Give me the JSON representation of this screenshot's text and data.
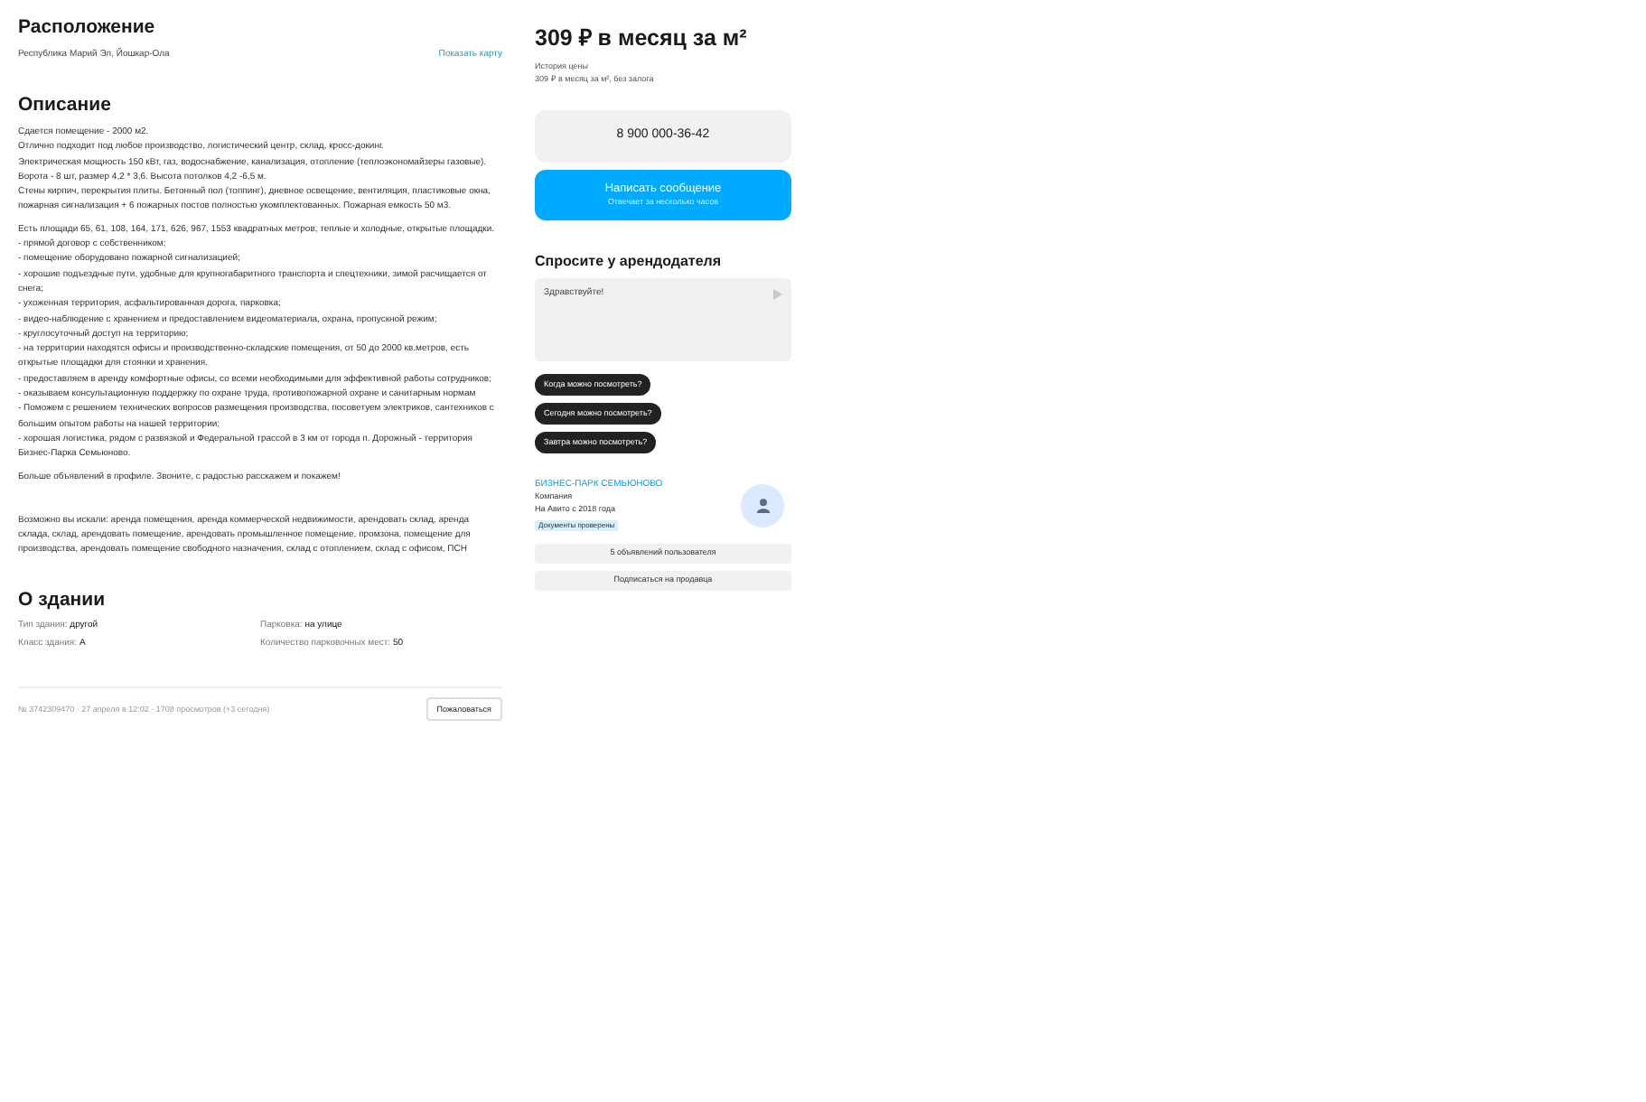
{
  "location": {
    "title": "Расположение",
    "address": "Республика Марий Эл, Йошкар-Ола",
    "map_link": "Показать карту"
  },
  "description": {
    "title": "Описание",
    "blocks": [
      [
        "Сдается помещение - 2000 м2.",
        "Отлично подходит под любое производство, логистический центр, склад, кросс-докинг.",
        "Электрическая мощность 150 кВт, газ, водоснабжение, канализация, отопление (теплоэкономайзеры газовые).",
        "Ворота - 8 шт, размер 4,2 * 3,6. Высота потолков 4,2 -6,5 м.",
        "Стены кирпич, перекрытия плиты. Бетонный пол (топпинг), дневное освещение, вентиляция, пластиковые окна, пожарная сигнализация + 6 пожарных постов полностью укомплектованных. Пожарная емкость 50 м3."
      ],
      [
        "Есть площади 65, 61, 108, 164, 171, 626, 967, 1553 квадратных метров, теплые и холодные, открытые площадки.",
        "- прямой договор с собственником;",
        "- помещение оборудовано пожарной сигнализацией;",
        "- хорошие подъездные пути, удобные для крупногабаритного транспорта и спецтехники, зимой расчищается от снега;",
        "- ухоженная территория, асфальтированная дорога, парковка;",
        "- видео-наблюдение с хранением и предоставлением видеоматериала, охрана, пропускной режим;",
        "- круглосуточный доступ на территорию;",
        "- на территории находятся офисы и производственно-складские помещения, от 50 до 2000 кв.метров, есть открытые площадки для стоянки и хранения.",
        "- предоставляем в аренду комфортные офисы, со всеми необходимыми для эффективной работы сотрудников;",
        "- оказываем консультационную поддержку по охране труда, противопожарной охране и санитарным нормам",
        "- Поможем с решением технических вопросов размещения производства, посоветуем электриков, сантехников с большим опытом работы на нашей территории;",
        "- хорошая логистика, рядом с развязкой и Федеральной трассой в 3 км от города п. Дорожный - территория Бизнес-Парка Семьюново."
      ],
      [
        "Больше объявлений в профиле. Звоните, с радостью расскажем и покажем!"
      ]
    ],
    "keywords": "Возможно вы искали: аренда помещения, аренда коммерческой недвижимости, арендовать склад, аренда склада, склад, арендовать помещение, арендовать промышленное помещение, промзона, помещение для производства, арендовать помещение свободного назначения, склад с отоплением, склад с офисом, ПСН"
  },
  "building": {
    "title": "О здании",
    "params": [
      {
        "label": "Тип здания:",
        "value": "другой"
      },
      {
        "label": "Парковка:",
        "value": "на улице"
      },
      {
        "label": "Класс здания:",
        "value": "А"
      },
      {
        "label": "Количество парковочных мест:",
        "value": "50"
      }
    ]
  },
  "footer": {
    "info": "№ 3742309470 · 27 апреля в 12:02 · 1708 просмотров (+3 сегодня)",
    "report_button": "Пожаловаться"
  },
  "price": {
    "title": "309 ₽ в месяц за м²",
    "history_link": "История цены",
    "note": "309 ₽ в месяц за м², без залога"
  },
  "phone_button": "8 900 000-36-42",
  "message_button": {
    "label": "Написать сообщение",
    "sublabel": "Отвечает за несколько часов"
  },
  "ask": {
    "title": "Спросите у арендодателя",
    "value": "Здравствуйте!",
    "suggestions": [
      "Когда можно посмотреть?",
      "Сегодня можно посмотреть?",
      "Завтра можно посмотреть?"
    ]
  },
  "seller": {
    "name": "БИЗНЕС-ПАРК СЕМЬЮНОВО",
    "type": "Компания",
    "since": "На Авито с 2018 года",
    "badge": "Документы проверены",
    "buttons": [
      "5 объявлений пользователя",
      "Подписаться на продавца"
    ]
  }
}
